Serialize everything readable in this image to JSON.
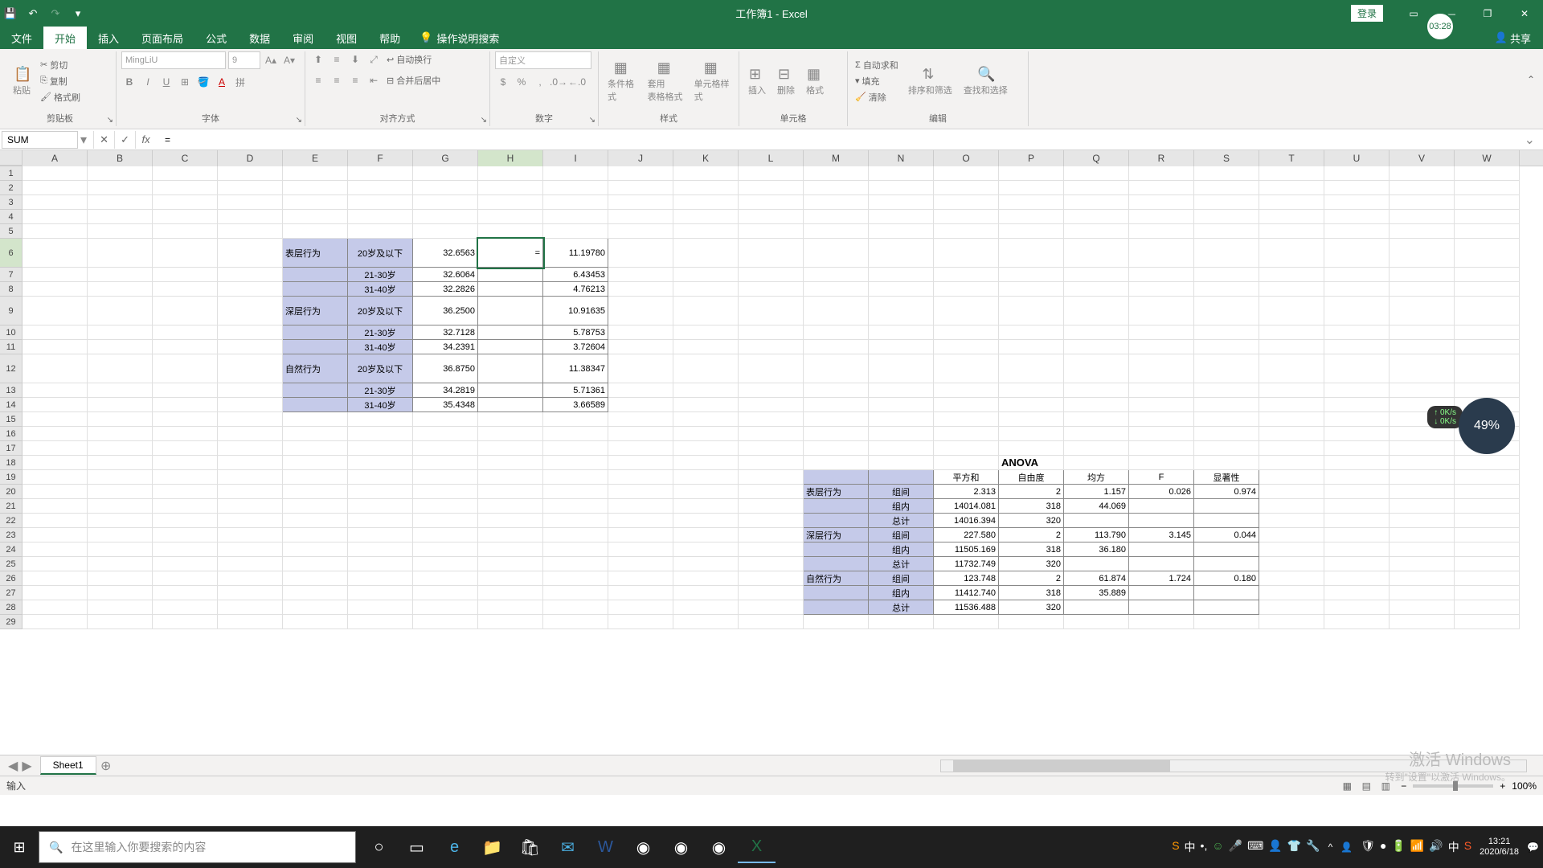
{
  "title": "工作簿1 - Excel",
  "login": "登录",
  "time_badge": "03:28",
  "share": "共享",
  "tabs": {
    "file": "文件",
    "home": "开始",
    "insert": "插入",
    "layout": "页面布局",
    "formulas": "公式",
    "data": "数据",
    "review": "审阅",
    "view": "视图",
    "help": "帮助",
    "tellme": "操作说明搜索"
  },
  "ribbon": {
    "clipboard": {
      "label": "剪贴板",
      "paste": "粘贴",
      "cut": "剪切",
      "copy": "复制",
      "painter": "格式刷"
    },
    "font": {
      "label": "字体",
      "name": "MingLiU",
      "size": "9"
    },
    "align": {
      "label": "对齐方式",
      "wrap": "自动换行",
      "merge": "合并后居中"
    },
    "number": {
      "label": "数字",
      "format": "自定义"
    },
    "styles": {
      "label": "样式",
      "cond": "条件格式",
      "table": "套用\n表格格式",
      "cell": "单元格样式"
    },
    "cells": {
      "label": "单元格",
      "insert": "插入",
      "delete": "删除",
      "format": "格式"
    },
    "editing": {
      "label": "编辑",
      "sum": "自动求和",
      "fill": "填充",
      "clear": "清除",
      "sort": "排序和筛选",
      "find": "查找和选择"
    }
  },
  "name_box": "SUM",
  "formula": "=",
  "columns": [
    "A",
    "B",
    "C",
    "D",
    "E",
    "F",
    "G",
    "H",
    "I",
    "J",
    "K",
    "L",
    "M",
    "N",
    "O",
    "P",
    "Q",
    "R",
    "S",
    "T",
    "U",
    "V",
    "W"
  ],
  "active_col": "H",
  "active_row": 6,
  "active_cell_value": "=",
  "table1": {
    "rows": [
      {
        "r": 6,
        "e": "表层行为",
        "f": "20岁及以下",
        "g": "32.6563",
        "h": "=",
        "i": "11.19780"
      },
      {
        "r": 7,
        "e": "",
        "f": "21-30岁",
        "g": "32.6064",
        "h": "",
        "i": "6.43453"
      },
      {
        "r": 8,
        "e": "",
        "f": "31-40岁",
        "g": "32.2826",
        "h": "",
        "i": "4.76213"
      },
      {
        "r": 9,
        "e": "深层行为",
        "f": "20岁及以下",
        "g": "36.2500",
        "h": "",
        "i": "10.91635"
      },
      {
        "r": 10,
        "e": "",
        "f": "21-30岁",
        "g": "32.7128",
        "h": "",
        "i": "5.78753"
      },
      {
        "r": 11,
        "e": "",
        "f": "31-40岁",
        "g": "34.2391",
        "h": "",
        "i": "3.72604"
      },
      {
        "r": 12,
        "e": "自然行为",
        "f": "20岁及以下",
        "g": "36.8750",
        "h": "",
        "i": "11.38347"
      },
      {
        "r": 13,
        "e": "",
        "f": "21-30岁",
        "g": "34.2819",
        "h": "",
        "i": "5.71361"
      },
      {
        "r": 14,
        "e": "",
        "f": "31-40岁",
        "g": "35.4348",
        "h": "",
        "i": "3.66589"
      }
    ]
  },
  "anova": {
    "title": "ANOVA",
    "headers": {
      "o": "平方和",
      "p": "自由度",
      "q": "均方",
      "r": "F",
      "s": "显著性"
    },
    "rows": [
      {
        "r": 20,
        "m": "表层行为",
        "n": "组间",
        "o": "2.313",
        "p": "2",
        "q": "1.157",
        "rr": "0.026",
        "s": "0.974"
      },
      {
        "r": 21,
        "m": "",
        "n": "组内",
        "o": "14014.081",
        "p": "318",
        "q": "44.069",
        "rr": "",
        "s": ""
      },
      {
        "r": 22,
        "m": "",
        "n": "总计",
        "o": "14016.394",
        "p": "320",
        "q": "",
        "rr": "",
        "s": ""
      },
      {
        "r": 23,
        "m": "深层行为",
        "n": "组间",
        "o": "227.580",
        "p": "2",
        "q": "113.790",
        "rr": "3.145",
        "s": "0.044"
      },
      {
        "r": 24,
        "m": "",
        "n": "组内",
        "o": "11505.169",
        "p": "318",
        "q": "36.180",
        "rr": "",
        "s": ""
      },
      {
        "r": 25,
        "m": "",
        "n": "总计",
        "o": "11732.749",
        "p": "320",
        "q": "",
        "rr": "",
        "s": ""
      },
      {
        "r": 26,
        "m": "自然行为",
        "n": "组间",
        "o": "123.748",
        "p": "2",
        "q": "61.874",
        "rr": "1.724",
        "s": "0.180"
      },
      {
        "r": 27,
        "m": "",
        "n": "组内",
        "o": "11412.740",
        "p": "318",
        "q": "35.889",
        "rr": "",
        "s": ""
      },
      {
        "r": 28,
        "m": "",
        "n": "总计",
        "o": "11536.488",
        "p": "320",
        "q": "",
        "rr": "",
        "s": ""
      }
    ]
  },
  "sheet_tab": "Sheet1",
  "status": "输入",
  "zoom": "100%",
  "taskbar": {
    "search_placeholder": "在这里输入你要搜索的内容",
    "time": "13:21",
    "date": "2020/6/18"
  },
  "net_badge": "49%",
  "net_up": "0K/s",
  "net_down": "0K/s",
  "activation": {
    "l1": "激活 Windows",
    "l2": "转到\"设置\"以激活 Windows。"
  }
}
